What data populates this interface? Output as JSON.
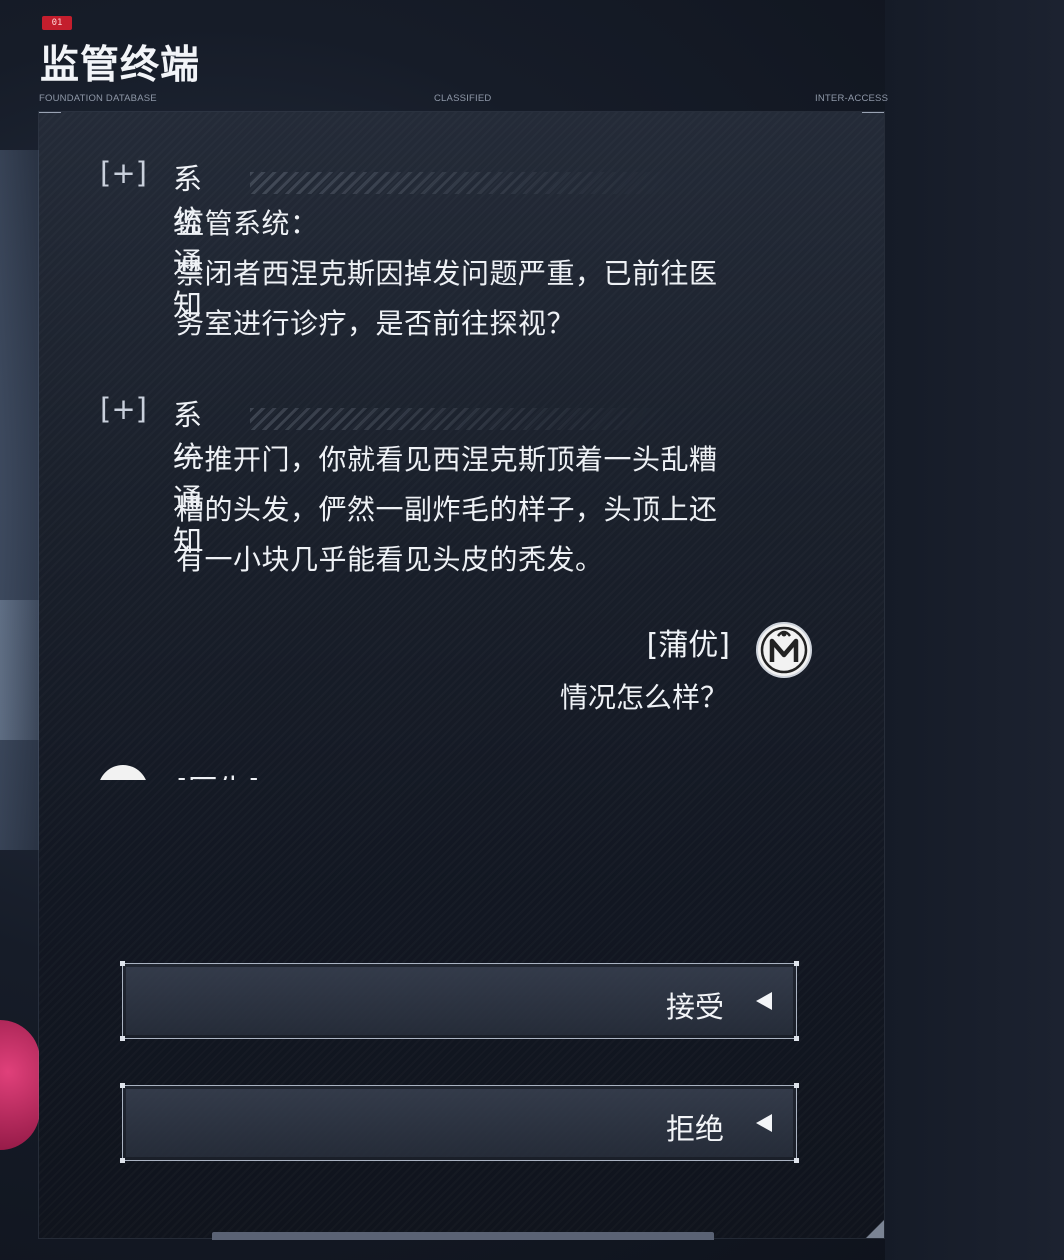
{
  "header": {
    "badge": "01",
    "title": "监管终端",
    "meta_left": "FOUNDATION DATABASE",
    "meta_center": "CLASSIFIED",
    "meta_right": "INTER-ACCESS"
  },
  "messages": [
    {
      "bracket": "[+]",
      "title": "系统通知",
      "lines": [
        "监管系统：",
        "禁闭者西涅克斯因掉发问题严重，已前往医",
        "务室进行诊疗，是否前往探视？"
      ]
    },
    {
      "bracket": "[+]",
      "title": "系统通知",
      "lines": [
        "一推开门，你就看见西涅克斯顶着一头乱糟",
        "糟的头发，俨然一副炸毛的样子，头顶上还",
        "有一小块几乎能看见头皮的秃发。"
      ]
    }
  ],
  "dialog": {
    "speaker": "[蒲优]",
    "avatar_icon": "m-emblem-icon",
    "text": "情况怎么样？",
    "next_speaker_partial": "[医生]"
  },
  "choices": {
    "accept": "接受",
    "decline": "拒绝",
    "arrow_icon": "triangle-left-icon"
  },
  "colors": {
    "accent_red": "#c41e2d",
    "panel": "#1a202b",
    "text": "#eef1f5"
  }
}
